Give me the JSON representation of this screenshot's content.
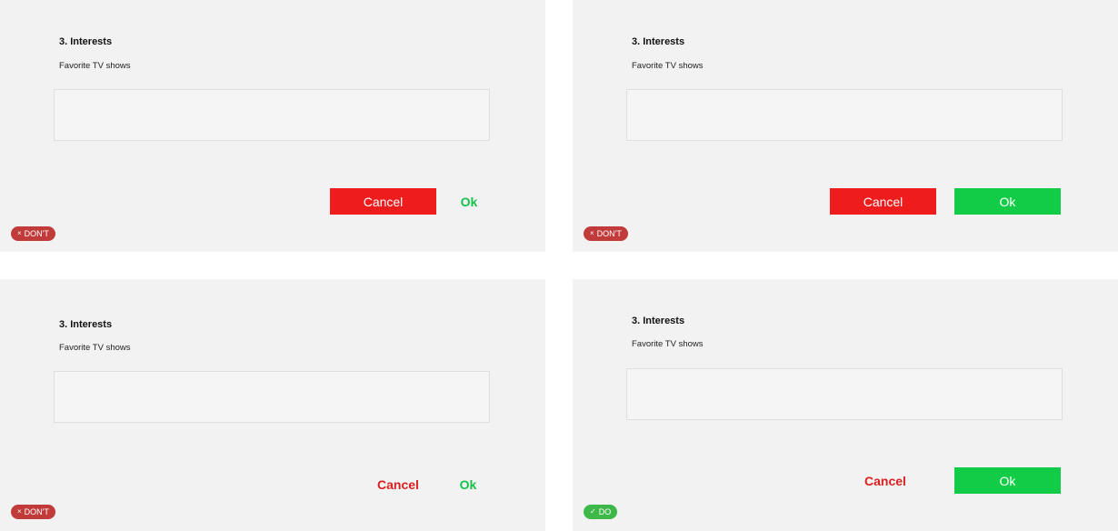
{
  "panels": [
    {
      "heading": "3. Interests",
      "label": "Favorite TV shows",
      "cancel": "Cancel",
      "ok": "Ok",
      "badge": "DON'T",
      "badge_icon": "×"
    },
    {
      "heading": "3. Interests",
      "label": "Favorite TV shows",
      "cancel": "Cancel",
      "ok": "Ok",
      "badge": "DON'T",
      "badge_icon": "×"
    },
    {
      "heading": "3. Interests",
      "label": "Favorite TV shows",
      "cancel": "Cancel",
      "ok": "Ok",
      "badge": "DON'T",
      "badge_icon": "×"
    },
    {
      "heading": "3. Interests",
      "label": "Favorite TV shows",
      "cancel": "Cancel",
      "ok": "Ok",
      "badge": "DO",
      "badge_icon": "✓"
    }
  ],
  "colors": {
    "cancel_red": "#ee1c1c",
    "ok_green": "#12cc48",
    "dont_badge": "#c23b3b",
    "do_badge": "#3fb84a",
    "panel_bg": "#f2f2f2"
  },
  "icons": {
    "dont_icon": "close-icon",
    "do_icon": "check-icon"
  }
}
